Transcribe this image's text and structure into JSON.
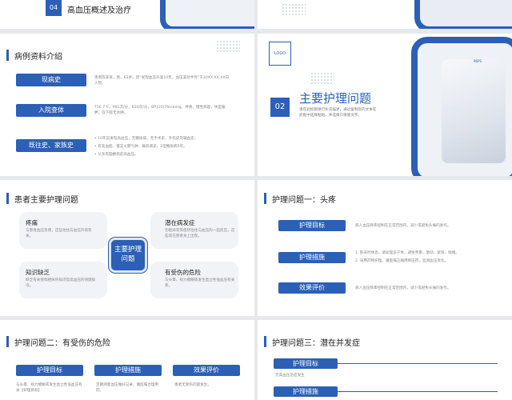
{
  "slide1": {
    "number": "04",
    "title": "高血压概述及治疗"
  },
  "slide3": {
    "title": "病例资料介绍",
    "rows": [
      {
        "label": "现病史",
        "text": "患者陈某某，男，63岁。因“发现血压升高10年，血压波动半月”于20XX.XX.XX日入院。"
      },
      {
        "label": "入院查体",
        "text": "T36.7℃，P81次/分，R20次/分，BP120/76mmHg。神清，慢性病容，体型偏胖，双下肢无水肿。"
      },
      {
        "label": "既往史、家族史",
        "bullets": [
          "10年前发现高血压，无糖尿病、无手术史、外伤史及输血史。",
          "有高血脂、慢支炎肺气肿、痛风病史。2型糖尿病5年。",
          "父亲有脑梗病史高血压。"
        ]
      }
    ]
  },
  "slide4": {
    "logo": "LOGO",
    "number": "02",
    "title": "主要护理问题",
    "desc": "请在此标题进行补充描述，通过复制您的文本在此框中选择粘贴，并选择只保留文字。"
  },
  "slide5": {
    "title": "患者主要护理问题",
    "center": "主要护理问题",
    "items": [
      {
        "title": "疼痛",
        "text": "与患者血压急增，这些往往与血压升高有关。"
      },
      {
        "title": "潜在病发症",
        "text": "功能异常等症状往往与血压的一些反应，这些常在患者身上出现。"
      },
      {
        "title": "知识缺乏",
        "text": "缺乏有关疾病相关的知识及高血压的保健知识。"
      },
      {
        "title": "有受伤的危险",
        "text": "与头晕、视力模糊或发生直立性低血压有关系。"
      }
    ]
  },
  "slide6": {
    "title": "护理问题一：头疼",
    "rows": [
      {
        "label": "护理目标",
        "text": "病人血压降率控制在正常范围内，减少或避免头痛的发作。"
      },
      {
        "label": "护理措施",
        "bullets": [
          "1. 卧床时休息。调处理多于休，避免劳累、激动、紧张、情绪。",
          "2. 采用药物护理。遵医嘱正确用降压药，监测血压变化。"
        ]
      },
      {
        "label": "效果评价",
        "text": "病人血压降率控制在正常范围内，减少或避免头痛的发作。"
      }
    ]
  },
  "slide7": {
    "title": "护理问题二：有受伤的危险",
    "buttons": [
      "护理目标",
      "护理措施",
      "效果评价"
    ],
    "texts": [
      "与头晕、视力模糊或发生直立性低血压有关【护理目标】",
      "定期测量血压做好记录，遵医嘱合理用药。",
      "患者无受伤问题发生。"
    ]
  },
  "slide8": {
    "title": "护理问题三：潜在并发症",
    "labels": [
      "护理目标",
      "护理措施"
    ],
    "text": "无高血压急症发生"
  },
  "colors": {
    "accent": "#2c5fb6",
    "background": "#e6e8ec"
  }
}
